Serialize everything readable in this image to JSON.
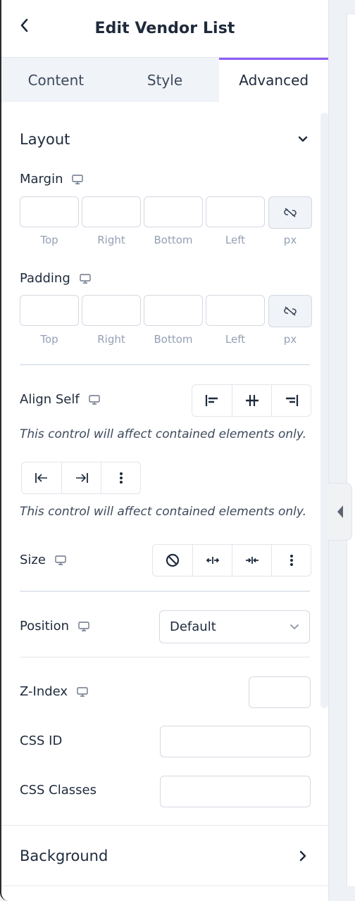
{
  "header": {
    "title": "Edit Vendor List",
    "back_icon": "chevron-left-icon"
  },
  "tabs": [
    {
      "label": "Content",
      "active": false
    },
    {
      "label": "Style",
      "active": false
    },
    {
      "label": "Advanced",
      "active": true
    }
  ],
  "accent_color": "#8b5cf6",
  "layout": {
    "title": "Layout",
    "expanded": true,
    "margin": {
      "label": "Margin",
      "values": {
        "top": "",
        "right": "",
        "bottom": "",
        "left": ""
      },
      "captions": [
        "Top",
        "Right",
        "Bottom",
        "Left"
      ],
      "unit": "px",
      "linked": false
    },
    "padding": {
      "label": "Padding",
      "values": {
        "top": "",
        "right": "",
        "bottom": "",
        "left": ""
      },
      "captions": [
        "Top",
        "Right",
        "Bottom",
        "Left"
      ],
      "unit": "px",
      "linked": false
    },
    "align_self": {
      "label": "Align Self",
      "options": [
        "align-start-icon",
        "align-center-icon",
        "align-end-icon"
      ],
      "hint": "This control will affect contained elements only."
    },
    "order": {
      "options": [
        "order-start-icon",
        "order-end-icon",
        "more-vertical-icon"
      ],
      "hint": "This control will affect contained elements only."
    },
    "size": {
      "label": "Size",
      "options": [
        "none-icon",
        "grow-icon",
        "shrink-icon",
        "more-vertical-icon"
      ]
    },
    "position": {
      "label": "Position",
      "value": "Default"
    },
    "z_index": {
      "label": "Z-Index",
      "value": ""
    },
    "css_id": {
      "label": "CSS ID",
      "value": ""
    },
    "css_classes": {
      "label": "CSS Classes",
      "value": ""
    }
  },
  "background": {
    "title": "Background",
    "expanded": false
  }
}
